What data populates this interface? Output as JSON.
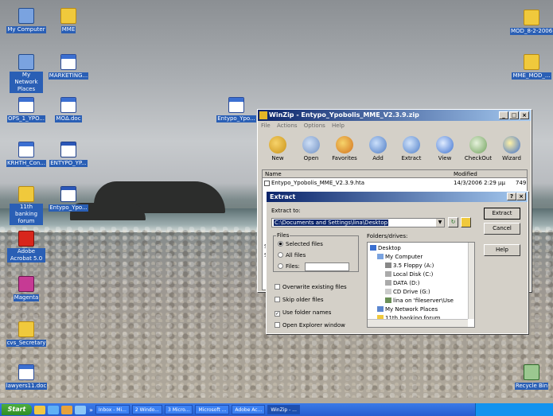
{
  "desktop": {
    "icons": [
      {
        "label": "My Computer",
        "kind": "comp"
      },
      {
        "label": "MME",
        "kind": "folder"
      },
      {
        "label": "My Network Places",
        "kind": "comp"
      },
      {
        "label": "MARKETING...",
        "kind": "doc"
      },
      {
        "label": "OPS_1_YPO...",
        "kind": "doc"
      },
      {
        "label": "MOΔ.doc",
        "kind": "doc"
      },
      {
        "label": "KRHTH_Con...",
        "kind": "doc"
      },
      {
        "label": "ENTYPO_YP...",
        "kind": "win"
      },
      {
        "label": "11th banking forum",
        "kind": "folder"
      },
      {
        "label": "Entypo_Ypo...",
        "kind": "win"
      },
      {
        "label": "Adobe Acrobat 5.0",
        "kind": "pdf"
      },
      {
        "label": "Magenta",
        "kind": "mag"
      },
      {
        "label": "cvs_Secretary",
        "kind": "folder"
      },
      {
        "label": "lawyers11.doc",
        "kind": "doc"
      },
      {
        "label": "Entypo_Ypo...",
        "kind": "doc"
      },
      {
        "label": "MOD_8-2-2006",
        "kind": "folder"
      },
      {
        "label": "MME_MOD_...",
        "kind": "folder"
      },
      {
        "label": "Recycle Bin",
        "kind": "recy"
      }
    ]
  },
  "winzip": {
    "title": "WinZip - Entypo_Ypobolis_MME_V2.3.9.zip",
    "menu": [
      "File",
      "Actions",
      "Options",
      "Help"
    ],
    "toolbar": [
      "New",
      "Open",
      "Favorites",
      "Add",
      "Extract",
      "View",
      "CheckOut",
      "Wizard"
    ],
    "columns": {
      "name": "Name",
      "modified": "Modified"
    },
    "file": {
      "name": "Entypo_Ypobolis_MME_V2.3.9.hta",
      "modified": "14/3/2006 2:29 μμ",
      "size": "749"
    },
    "partial_s": "S",
    "partial_se": "Se"
  },
  "extract": {
    "title": "Extract",
    "help_glyph": "?",
    "close_glyph": "×",
    "extract_to_label": "Extract to:",
    "extract_to_value": "C:\\Documents and Settings\\lina\\Desktop",
    "buttons": {
      "extract": "Extract",
      "cancel": "Cancel",
      "help": "Help"
    },
    "files_group": "Files",
    "radios": [
      "Selected files",
      "All files",
      "Files:"
    ],
    "checks": [
      {
        "label": "Overwrite existing files",
        "checked": false
      },
      {
        "label": "Skip older files",
        "checked": false
      },
      {
        "label": "Use folder names",
        "checked": true
      },
      {
        "label": "Open Explorer window",
        "checked": false
      }
    ],
    "folders_label": "Folders/drives:",
    "tree": [
      "Desktop",
      "My Computer",
      "3.5 Floppy (A:)",
      "Local Disk (C:)",
      "DATA (D:)",
      "CD Drive (G:)",
      "lina on 'fileserver\\Use",
      "My Network Places",
      "11th banking forum"
    ]
  },
  "taskbar": {
    "start": "Start",
    "chevron": "»",
    "tasks": [
      "Inbox - Mi...",
      "2 Windo...",
      "3 Micro...",
      "Microsoft ...",
      "Adobe Ac...",
      "WinZip - ..."
    ]
  }
}
